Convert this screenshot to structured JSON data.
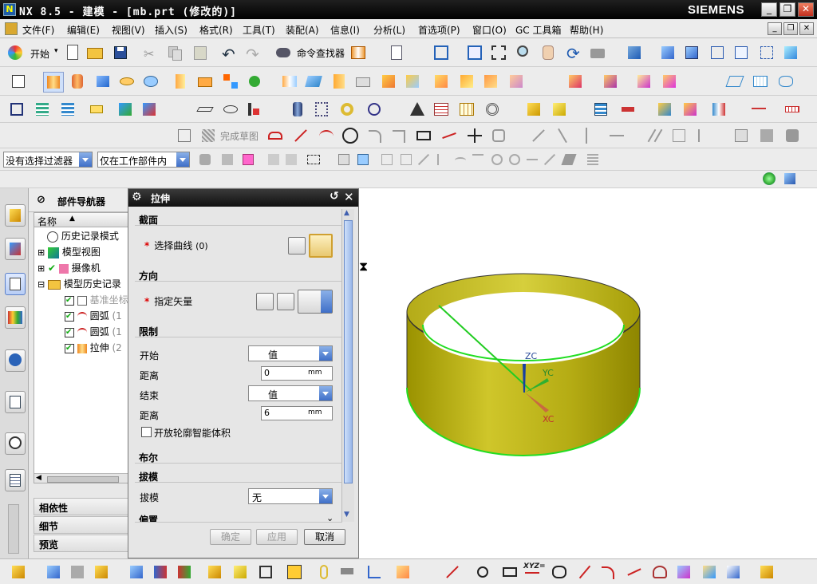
{
  "window": {
    "title": "NX 8.5 - 建模 - [mb.prt (修改的)]",
    "brand": "SIEMENS",
    "buttons": [
      "_",
      "❐",
      "✕"
    ]
  },
  "menu": {
    "items": [
      "文件(F)",
      "编辑(E)",
      "视图(V)",
      "插入(S)",
      "格式(R)",
      "工具(T)",
      "装配(A)",
      "信息(I)",
      "分析(L)",
      "首选项(P)",
      "窗口(O)",
      "GC 工具箱",
      "帮助(H)"
    ]
  },
  "toolbar": {
    "start_label": "开始",
    "command_finder_label": "命令查找器",
    "finish_sketch_label": "完成草图",
    "filter_select": "没有选择过滤器",
    "scope_select": "仅在工作部件内"
  },
  "navigator": {
    "title": "部件导航器",
    "column_header": "名称",
    "tree": [
      {
        "label": "历史记录模式"
      },
      {
        "label": "模型视图"
      },
      {
        "label": "摄像机"
      },
      {
        "label": "模型历史记录"
      },
      {
        "label": "基准坐标"
      },
      {
        "label": "圆弧",
        "suffix": "(1"
      },
      {
        "label": "圆弧",
        "suffix": "(1"
      },
      {
        "label": "拉伸",
        "suffix": "(2"
      }
    ],
    "sections": [
      "相依性",
      "细节",
      "预览"
    ]
  },
  "dialog": {
    "title": "拉伸",
    "section_label": "截面",
    "select_curve_label": "选择曲线",
    "select_curve_count": "(0)",
    "direction_label": "方向",
    "specify_vector_label": "指定矢量",
    "limits_label": "限制",
    "start_label": "开始",
    "start_value": "值",
    "start_distance_label": "距离",
    "start_distance_value": "0",
    "unit": "mm",
    "end_label": "结束",
    "end_value": "值",
    "end_distance_label": "距离",
    "end_distance_value": "6",
    "open_profile_label": "开放轮廓智能体积",
    "boolean_label": "布尔",
    "draft_group_label": "拔模",
    "draft_label": "拔模",
    "draft_value": "无",
    "offset_label": "偏置",
    "ok_label": "确定",
    "apply_label": "应用",
    "cancel_label": "取消"
  },
  "viewport": {
    "axes": {
      "z": "ZC",
      "y": "YC",
      "x": "XC"
    },
    "model_color": "#c8c020",
    "edge_color": "#22dd22"
  }
}
